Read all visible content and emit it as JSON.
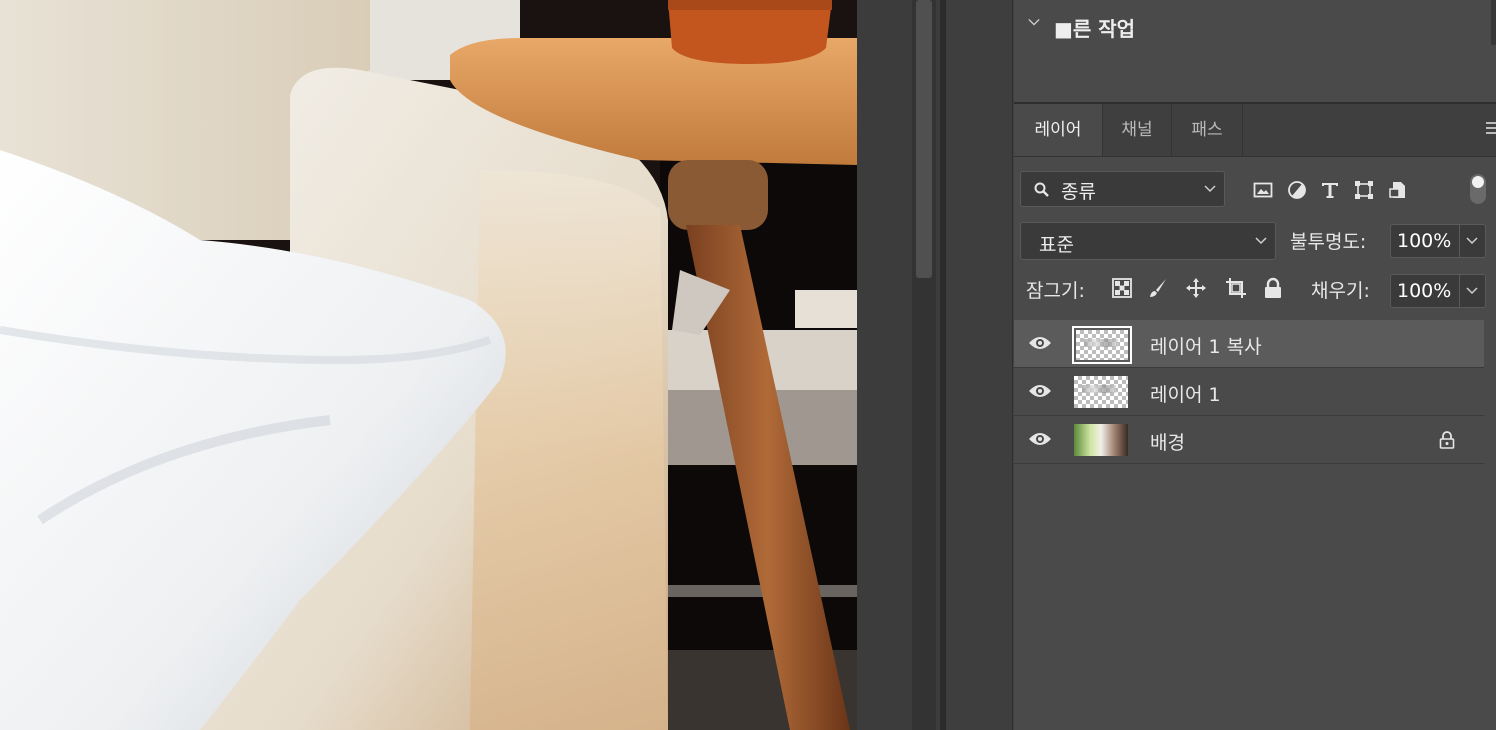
{
  "canvas": {
    "description_icon": "photo-canvas"
  },
  "quick_actions": {
    "title": "■른 작업"
  },
  "layers_panel": {
    "tabs": [
      {
        "label": "레이어",
        "active": true
      },
      {
        "label": "채널",
        "active": false
      },
      {
        "label": "패스",
        "active": false
      }
    ],
    "filter": {
      "value": "종류"
    },
    "filter_icons": [
      "image-filter-icon",
      "adjustment-filter-icon",
      "type-filter-icon",
      "shape-filter-icon",
      "smart-object-filter-icon"
    ],
    "blend_mode": "표준",
    "opacity_label": "불투명도:",
    "opacity_value": "100%",
    "lock_label": "잠그기:",
    "lock_icons": [
      "lock-transparent-icon",
      "lock-image-icon",
      "lock-position-icon",
      "lock-artboard-icon",
      "lock-all-icon"
    ],
    "fill_label": "채우기:",
    "fill_value": "100%",
    "layers": [
      {
        "name": "레이어 1 복사",
        "selected": true,
        "visible": true,
        "locked": false,
        "thumb": "transparent"
      },
      {
        "name": "레이어 1",
        "selected": false,
        "visible": true,
        "locked": false,
        "thumb": "transparent"
      },
      {
        "name": "배경",
        "selected": false,
        "visible": true,
        "locked": true,
        "thumb": "photo"
      }
    ]
  },
  "colors": {
    "panel_bg": "#4a4a4a",
    "selected_row": "#5b5b5b",
    "text": "#e8e8e8"
  }
}
